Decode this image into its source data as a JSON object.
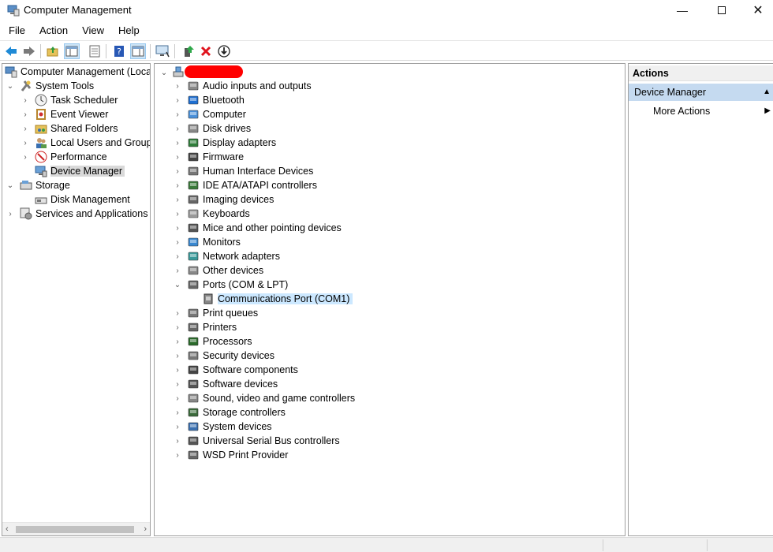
{
  "window": {
    "title": "Computer Management",
    "minimize_glyph": "—",
    "close_glyph": "✕"
  },
  "menu": [
    "File",
    "Action",
    "View",
    "Help"
  ],
  "toolbar": {
    "buttons": [
      "back-icon",
      "forward-icon",
      "up-folder-icon",
      "show-hide-console-tree-icon",
      "properties-icon",
      "help-icon",
      "show-hide-action-pane-icon",
      "computer-monitor-icon",
      "update-driver-icon",
      "uninstall-device-icon",
      "download-icon"
    ]
  },
  "left_tree": {
    "root": "Computer Management (Local",
    "items": [
      {
        "label": "System Tools",
        "icon": "tools-icon"
      },
      {
        "label": "Task Scheduler",
        "icon": "clock-icon"
      },
      {
        "label": "Event Viewer",
        "icon": "event-viewer-icon"
      },
      {
        "label": "Shared Folders",
        "icon": "shared-folder-icon"
      },
      {
        "label": "Local Users and Groups",
        "icon": "users-icon"
      },
      {
        "label": "Performance",
        "icon": "performance-icon"
      },
      {
        "label": "Device Manager",
        "icon": "device-manager-icon"
      },
      {
        "label": "Storage",
        "icon": "storage-icon"
      },
      {
        "label": "Disk Management",
        "icon": "disk-management-icon"
      },
      {
        "label": "Services and Applications",
        "icon": "services-icon"
      }
    ]
  },
  "device_tree": {
    "categories": [
      "Audio inputs and outputs",
      "Bluetooth",
      "Computer",
      "Disk drives",
      "Display adapters",
      "Firmware",
      "Human Interface Devices",
      "IDE ATA/ATAPI controllers",
      "Imaging devices",
      "Keyboards",
      "Mice and other pointing devices",
      "Monitors",
      "Network adapters",
      "Other devices",
      "Ports (COM & LPT)",
      "Print queues",
      "Printers",
      "Processors",
      "Security devices",
      "Software components",
      "Software devices",
      "Sound, video and game controllers",
      "Storage controllers",
      "System devices",
      "Universal Serial Bus controllers",
      "WSD Print Provider"
    ],
    "expanded_child": "Communications Port (COM1)"
  },
  "actions": {
    "header": "Actions",
    "section": "Device Manager",
    "item": "More Actions"
  },
  "colors": {
    "selection_gray": "#d9d9d9",
    "selection_blue": "#cce8ff",
    "actions_section": "#c5daf0",
    "redaction": "#ff0000"
  }
}
